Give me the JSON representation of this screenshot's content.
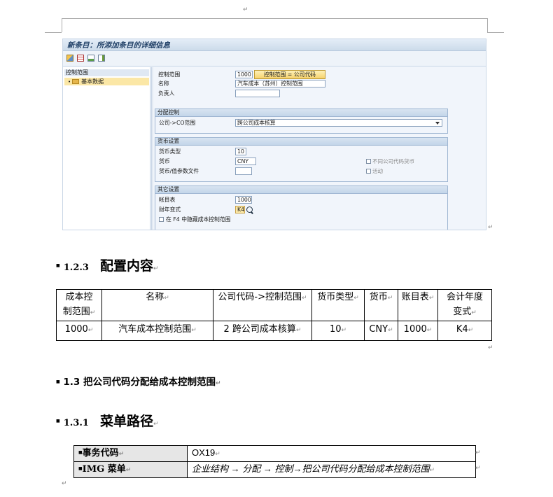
{
  "paragraph_mark": "↵",
  "sap": {
    "title": "新条目：所添加条目的详细信息",
    "tree": {
      "header": "控制范围",
      "item": "基本数据"
    },
    "fields": {
      "ctrl_area_label": "控制范围",
      "ctrl_area_value": "1000",
      "ctrl_area_button": "控制范围 = 公司代码",
      "name_label": "名称",
      "name_value": "汽车成本（苏州）控制范围",
      "responsible_label": "负责人",
      "responsible_value": ""
    },
    "assignment": {
      "header": "分配控制",
      "label": "公司->CO范围",
      "value": "跨公司成本核算"
    },
    "currency": {
      "header": "货币设置",
      "type_label": "货币类型",
      "type_value": "10",
      "currency_label": "货币",
      "currency_value": "CNY",
      "profile_label": "货币/值参数文件",
      "profile_value": "",
      "cb_diff_currency": "不同公司代码货币",
      "cb_active": "活动"
    },
    "other": {
      "header": "其它设置",
      "coa_label": "帐目表",
      "coa_value": "1000",
      "fy_label": "财年变式",
      "fy_value": "K4",
      "cb_hide": "在 F4 中隐藏成本控制范围"
    }
  },
  "section_123": {
    "number": "1.2.3",
    "title": "配置内容"
  },
  "config_table": {
    "headers": [
      "成本控制范围",
      "名称",
      "公司代码->控制范围",
      "货币类型",
      "货币",
      "账目表",
      "会计年度变式"
    ],
    "headers_line1": [
      "成本控",
      "名称",
      "公司代码->控制范围",
      "货币类型",
      "货币",
      "账目表",
      "会计年度"
    ],
    "headers_line2": [
      "制范围",
      "",
      "",
      "",
      "",
      "",
      "变式"
    ],
    "row": [
      "1000",
      "汽车成本控制范围",
      "2 跨公司成本核算",
      "10",
      "CNY",
      "1000",
      "K4"
    ]
  },
  "section_13": {
    "title": "1.3 把公司代码分配给成本控制范围"
  },
  "section_131": {
    "number": "1.3.1",
    "title": "菜单路径"
  },
  "path_table": {
    "tcode_label": "事务代码",
    "tcode_value": "OX19",
    "img_label": "IMG 菜单",
    "img_value": "企业结构 → 分配 → 控制→把公司代码分配给成本控制范围"
  }
}
